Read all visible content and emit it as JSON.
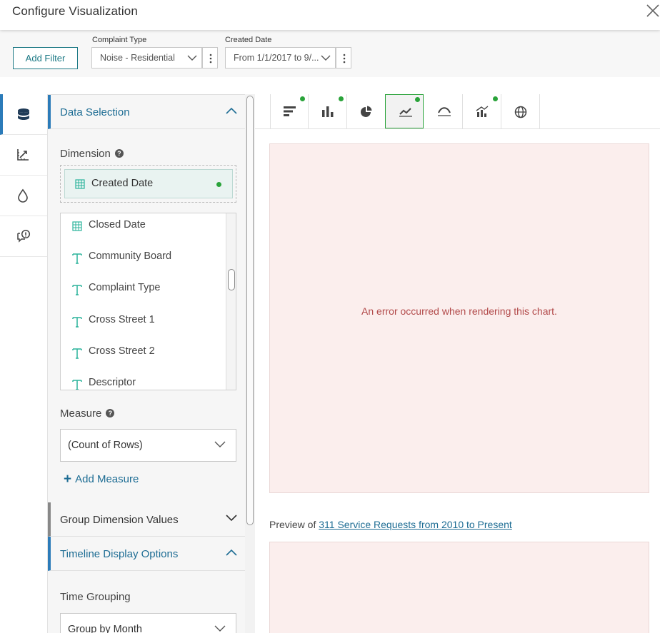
{
  "header": {
    "title": "Configure Visualization",
    "close_icon": "close-icon"
  },
  "filterbar": {
    "add_filter_label": "Add Filter",
    "filters": [
      {
        "label": "Complaint Type",
        "value": "Noise - Residential"
      },
      {
        "label": "Created Date",
        "value": "From 1/1/2017 to 9/..."
      }
    ]
  },
  "rail": {
    "items": [
      "database-icon",
      "axis-chart-icon",
      "droplet-icon",
      "info-chat-icon"
    ]
  },
  "panel": {
    "data_selection": {
      "title": "Data Selection",
      "dimension_label": "Dimension",
      "help_glyph": "?",
      "selected_dimension": "Created Date",
      "columns": [
        {
          "name": "Closed Date",
          "type": "date"
        },
        {
          "name": "Community Board",
          "type": "text"
        },
        {
          "name": "Complaint Type",
          "type": "text"
        },
        {
          "name": "Cross Street 1",
          "type": "text"
        },
        {
          "name": "Cross Street 2",
          "type": "text"
        },
        {
          "name": "Descriptor",
          "type": "text"
        }
      ],
      "measure_label": "Measure",
      "measure_value": "(Count of Rows)",
      "add_measure_label": "Add Measure",
      "add_measure_plus": "+"
    },
    "group_dimension_title": "Group Dimension Values",
    "timeline_options_title": "Timeline Display Options",
    "time_grouping_label": "Time Grouping",
    "time_grouping_value": "Group by Month"
  },
  "viz": {
    "chart_types": [
      {
        "icon": "horizontal-bar-chart-icon",
        "dot": true,
        "active": false
      },
      {
        "icon": "column-chart-icon",
        "dot": true,
        "active": false
      },
      {
        "icon": "pie-chart-icon",
        "dot": false,
        "active": false
      },
      {
        "icon": "timeline-chart-icon",
        "dot": true,
        "active": true
      },
      {
        "icon": "histogram-curve-icon",
        "dot": false,
        "active": false
      },
      {
        "icon": "combo-chart-icon",
        "dot": true,
        "active": false
      },
      {
        "icon": "globe-map-icon",
        "dot": false,
        "active": false
      }
    ],
    "error_message": "An error occurred when rendering this chart.",
    "preview_prefix": "Preview of",
    "preview_link": "311 Service Requests from 2010 to Present"
  },
  "colors": {
    "accent": "#1e6d94",
    "active_border": "#2b7bb9",
    "status_dot": "#2aa33a",
    "error_bg": "#fbeeed",
    "error_text": "#b24a4a"
  }
}
